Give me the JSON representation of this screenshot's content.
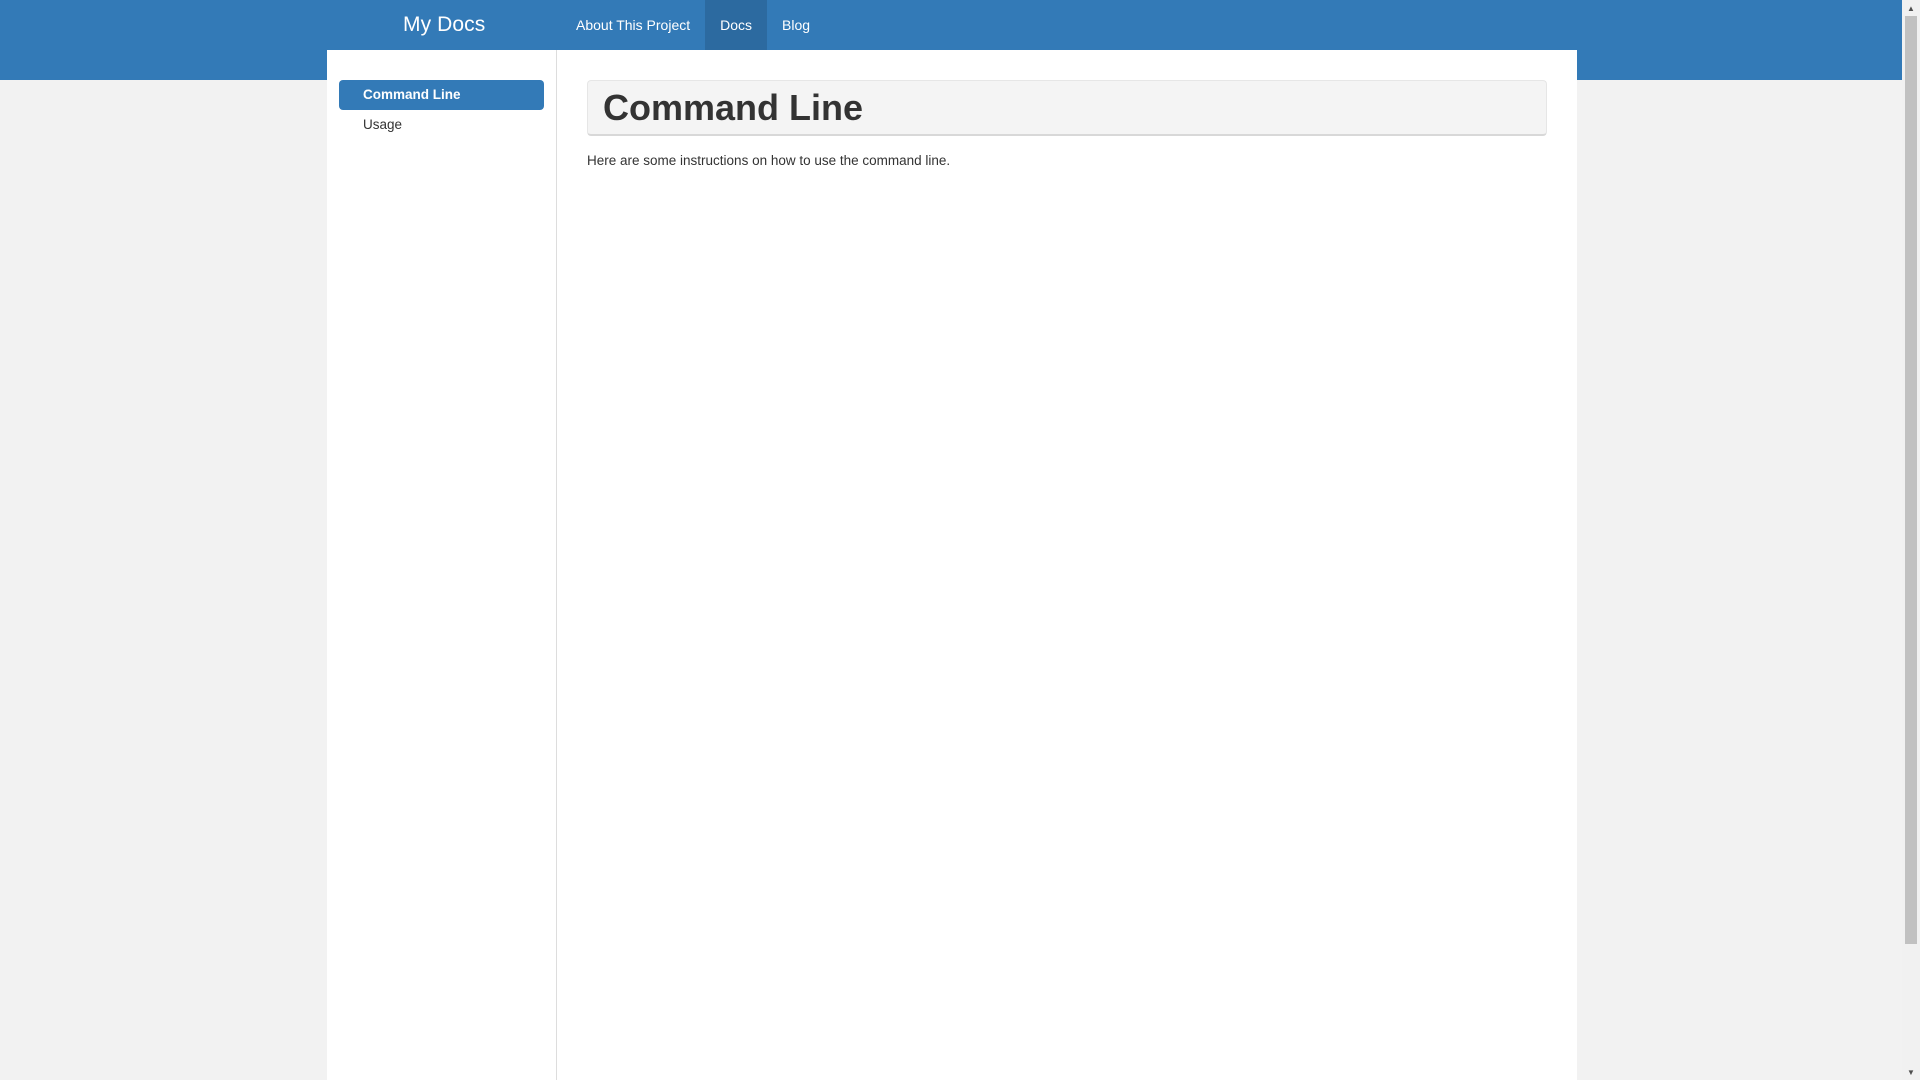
{
  "header": {
    "brand": "My Docs",
    "nav": [
      {
        "label": "About This Project",
        "active": false
      },
      {
        "label": "Docs",
        "active": true
      },
      {
        "label": "Blog",
        "active": false
      }
    ]
  },
  "sidebar": {
    "items": [
      {
        "label": "Command Line",
        "active": true
      },
      {
        "label": "Usage",
        "active": false
      }
    ]
  },
  "main": {
    "title": "Command Line",
    "body": "Here are some instructions on how to use the command line."
  },
  "scrollbar": {
    "up_icon": "triangle-up",
    "down_icon": "triangle-down"
  },
  "colors": {
    "accent": "#337ab7",
    "nav_active": "#2c6aa0",
    "page_background": "#f2f2f2"
  }
}
